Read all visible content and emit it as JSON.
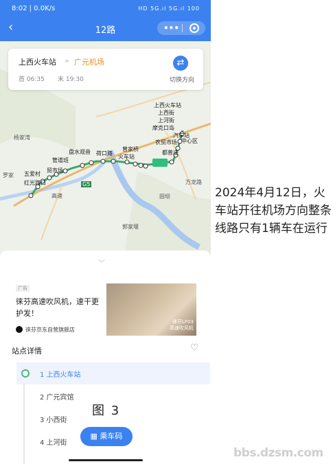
{
  "status_bar": {
    "time": "8:02 | 0.0K/s",
    "icons": "HD 5G.ıl 5G.ıl 100"
  },
  "header": {
    "title": "12路",
    "more_icon": "more-dots-icon",
    "close_icon": "target-close-icon"
  },
  "route_card": {
    "origin": "上西火车站",
    "separator": "»",
    "destination": "广元机场",
    "first_bus": "首 06:35",
    "last_bus": "末 19:30",
    "switch_label": "切换方向"
  },
  "map": {
    "place_labels": [
      "杨家湾",
      "罗家",
      "田坝",
      "郭家堰",
      "万龙路",
      "高速",
      "G5"
    ],
    "stop_labels": [
      "上西火车站",
      "上河街",
      "上西街",
      "摩克口岛",
      "汽车站",
      "中心区",
      "农贸市场",
      "五爱村",
      "红光路口",
      "贸市场",
      "火车站",
      "曾家桥",
      "盘水观音",
      "荷口路",
      "管道班",
      "都普庄"
    ],
    "colors": {
      "route": "#39a96b",
      "river": "#a9c8ef",
      "road": "#e8b86a",
      "bus": "#2fbf7a"
    }
  },
  "ad": {
    "tag": "广告",
    "text": "徕芬高速吹风机，速干更护发！",
    "store": "徕芬京东自营旗舰店",
    "image_caption": "徕芬LF03\n高速吹风机"
  },
  "stops_section": {
    "title": "站点详情",
    "stops": [
      {
        "name": "1 上西火车站",
        "active": true
      },
      {
        "name": "2 广元宾馆",
        "active": false
      },
      {
        "name": "3 小西街",
        "active": false
      },
      {
        "name": "4 上河街",
        "active": false
      }
    ]
  },
  "figure_label": "图  3",
  "ticket_button": "乘车码",
  "caption": "2024年4月12日，火车站开往机场方向整条线路只有1辆车在运行",
  "watermark": "bbs.dzsm.com"
}
